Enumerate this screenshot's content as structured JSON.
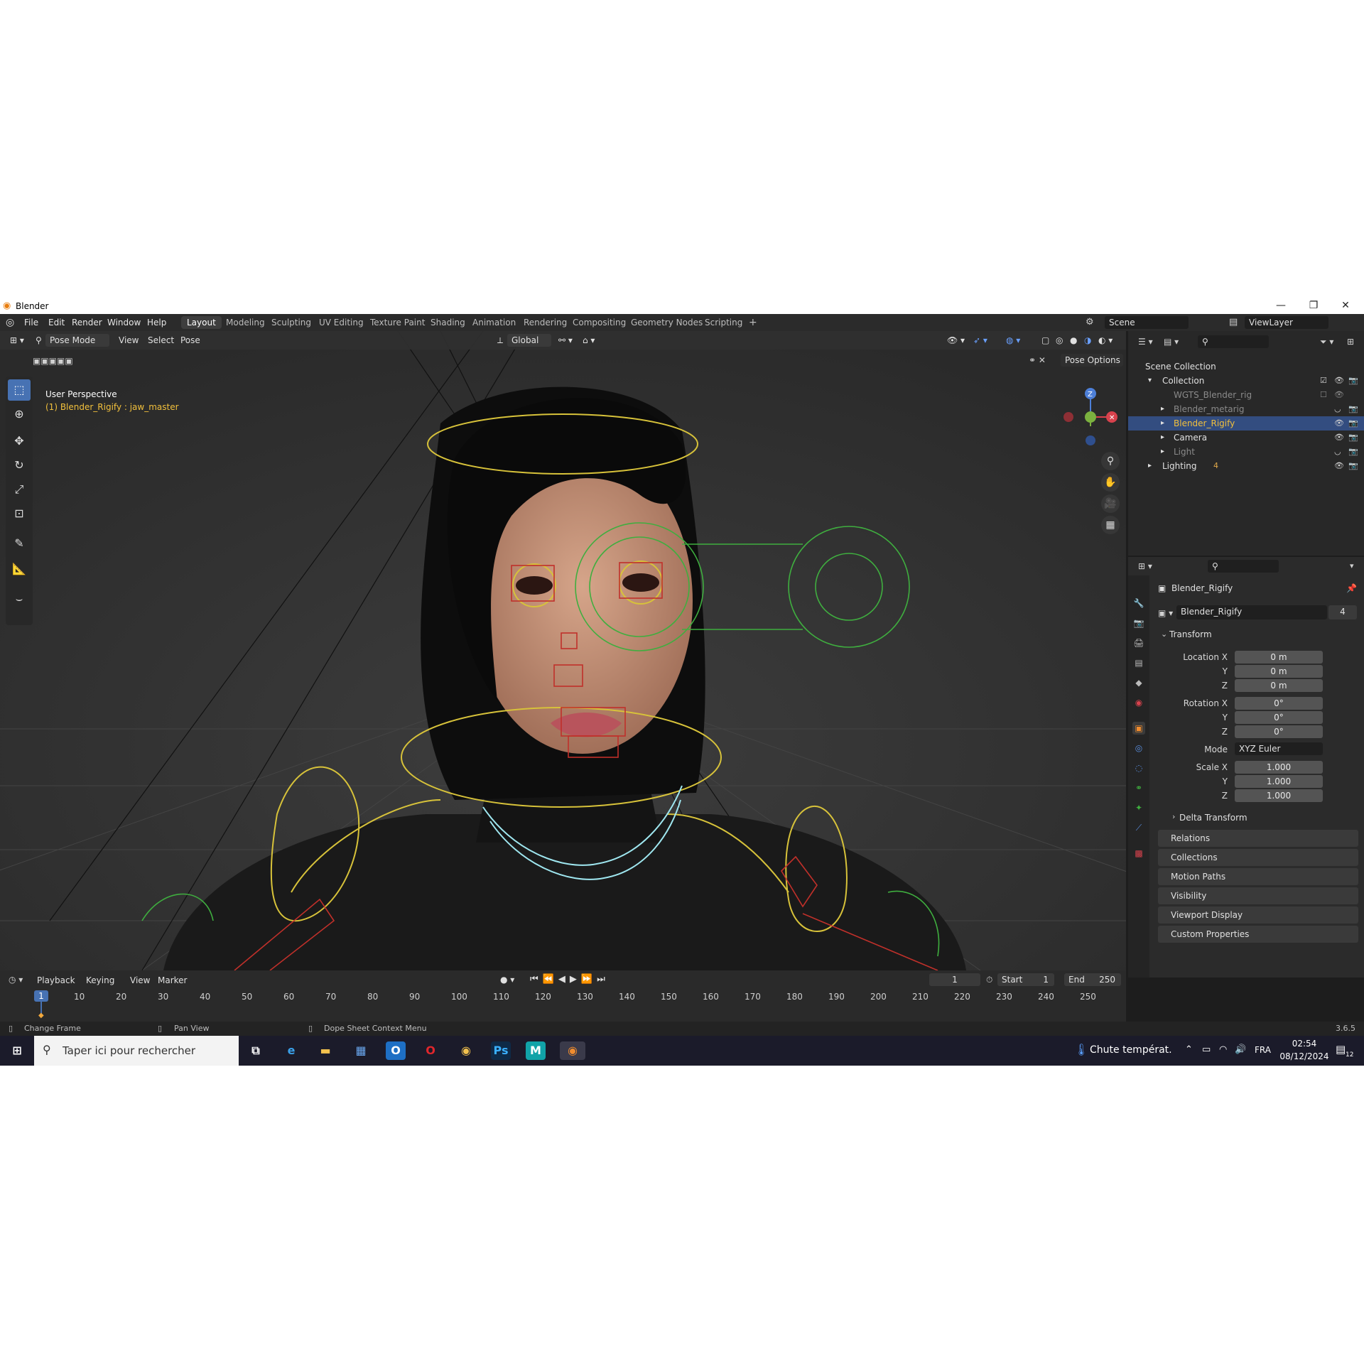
{
  "window": {
    "title": "Blender",
    "controls": [
      "—",
      "❐",
      "✕"
    ]
  },
  "menu": [
    "File",
    "Edit",
    "Render",
    "Window",
    "Help"
  ],
  "workspaces": [
    "Layout",
    "Modeling",
    "Sculpting",
    "UV Editing",
    "Texture Paint",
    "Shading",
    "Animation",
    "Rendering",
    "Compositing",
    "Geometry Nodes",
    "Scripting"
  ],
  "active_workspace": "Layout",
  "scene": {
    "name": "Scene",
    "view_layer": "ViewLayer"
  },
  "viewport_header": {
    "mode": "Pose Mode",
    "menus": [
      "View",
      "Select",
      "Pose"
    ],
    "orientation": "Global",
    "pose_options": "Pose Options"
  },
  "viewport": {
    "perspective": "User Perspective",
    "object_info": "(1) Blender_Rigify : jaw_master",
    "gizmo": {
      "z": "Z"
    }
  },
  "outliner": {
    "rows": [
      {
        "name": "Scene Collection",
        "dim": false
      },
      {
        "name": "Collection",
        "dim": false
      },
      {
        "name": "WGTS_Blender_rig",
        "dim": true
      },
      {
        "name": "Blender_metarig",
        "dim": true
      },
      {
        "name": "Blender_Rigify",
        "dim": false,
        "selected": true
      },
      {
        "name": "Camera",
        "dim": false
      },
      {
        "name": "Light",
        "dim": true
      },
      {
        "name": "Lighting",
        "dim": false,
        "badge": "4"
      }
    ]
  },
  "properties": {
    "object_name": "Blender_Rigify",
    "data_name": "Blender_Rigify",
    "users": "4",
    "transform_label": "Transform",
    "location": {
      "label": "Location X",
      "x": "0 m",
      "y": "0 m",
      "z": "0 m"
    },
    "rotation": {
      "label": "Rotation X",
      "x": "0°",
      "y": "0°",
      "z": "0°"
    },
    "mode": {
      "label": "Mode",
      "value": "XYZ Euler"
    },
    "scale": {
      "label": "Scale X",
      "x": "1.000",
      "y": "1.000",
      "z": "1.000"
    },
    "axis": {
      "y": "Y",
      "z": "Z"
    },
    "delta_transform": "Delta Transform",
    "panels": [
      "Relations",
      "Collections",
      "Motion Paths",
      "Visibility",
      "Viewport Display",
      "Custom Properties"
    ]
  },
  "timeline": {
    "menus": [
      "Playback",
      "Keying",
      "View",
      "Marker"
    ],
    "current_frame": "1",
    "start_label": "Start",
    "start": "1",
    "end_label": "End",
    "end": "250",
    "ticks": [
      "10",
      "20",
      "30",
      "40",
      "50",
      "60",
      "70",
      "80",
      "90",
      "100",
      "110",
      "120",
      "130",
      "140",
      "150",
      "160",
      "170",
      "180",
      "190",
      "200",
      "210",
      "220",
      "230",
      "240",
      "250"
    ]
  },
  "statusbar": {
    "hint1": "Change Frame",
    "hint2": "Pan View",
    "hint3": "Dope Sheet Context Menu",
    "version": "3.6.5"
  },
  "taskbar": {
    "search_placeholder": "Taper ici pour rechercher",
    "weather": "Chute températ.",
    "language": "FRA",
    "time": "02:54",
    "date": "08/12/2024",
    "notification_count": "12"
  },
  "colors": {
    "accent": "#4772b3",
    "selected_row": "#334d80",
    "rig_yellow": "#d7c23a",
    "rig_green": "#3fae3f",
    "rig_red": "#c0302a",
    "rig_cyan": "#9fe7f0"
  }
}
